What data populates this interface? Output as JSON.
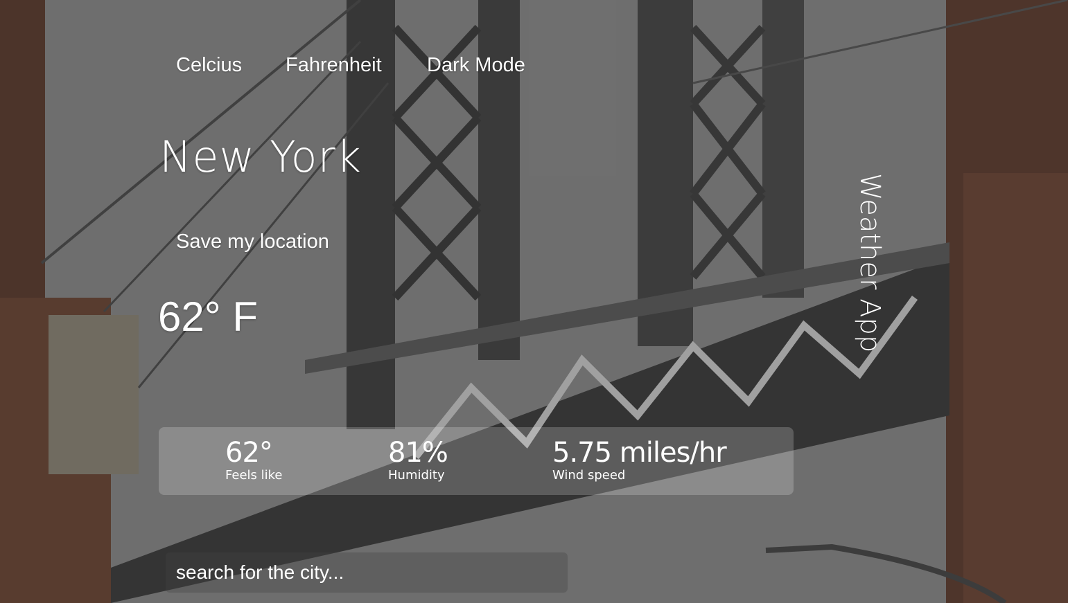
{
  "toolbar": {
    "celcius_label": "Celcius",
    "fahrenheit_label": "Fahrenheit",
    "dark_mode_label": "Dark Mode"
  },
  "location": {
    "city": "New York",
    "save_label": "Save my location"
  },
  "current": {
    "temperature": "62° F"
  },
  "app_title": "Weather App",
  "stats": {
    "feels_like": {
      "value": "62°",
      "label": "Feels like"
    },
    "humidity": {
      "value": "81%",
      "label": "Humidity"
    },
    "wind_speed": {
      "value": "5.75 miles/hr",
      "label": "Wind speed"
    }
  },
  "search": {
    "placeholder": "search for the city..."
  },
  "colors": {
    "text": "#ffffff",
    "panel": "rgba(255,255,255,0.20)"
  }
}
